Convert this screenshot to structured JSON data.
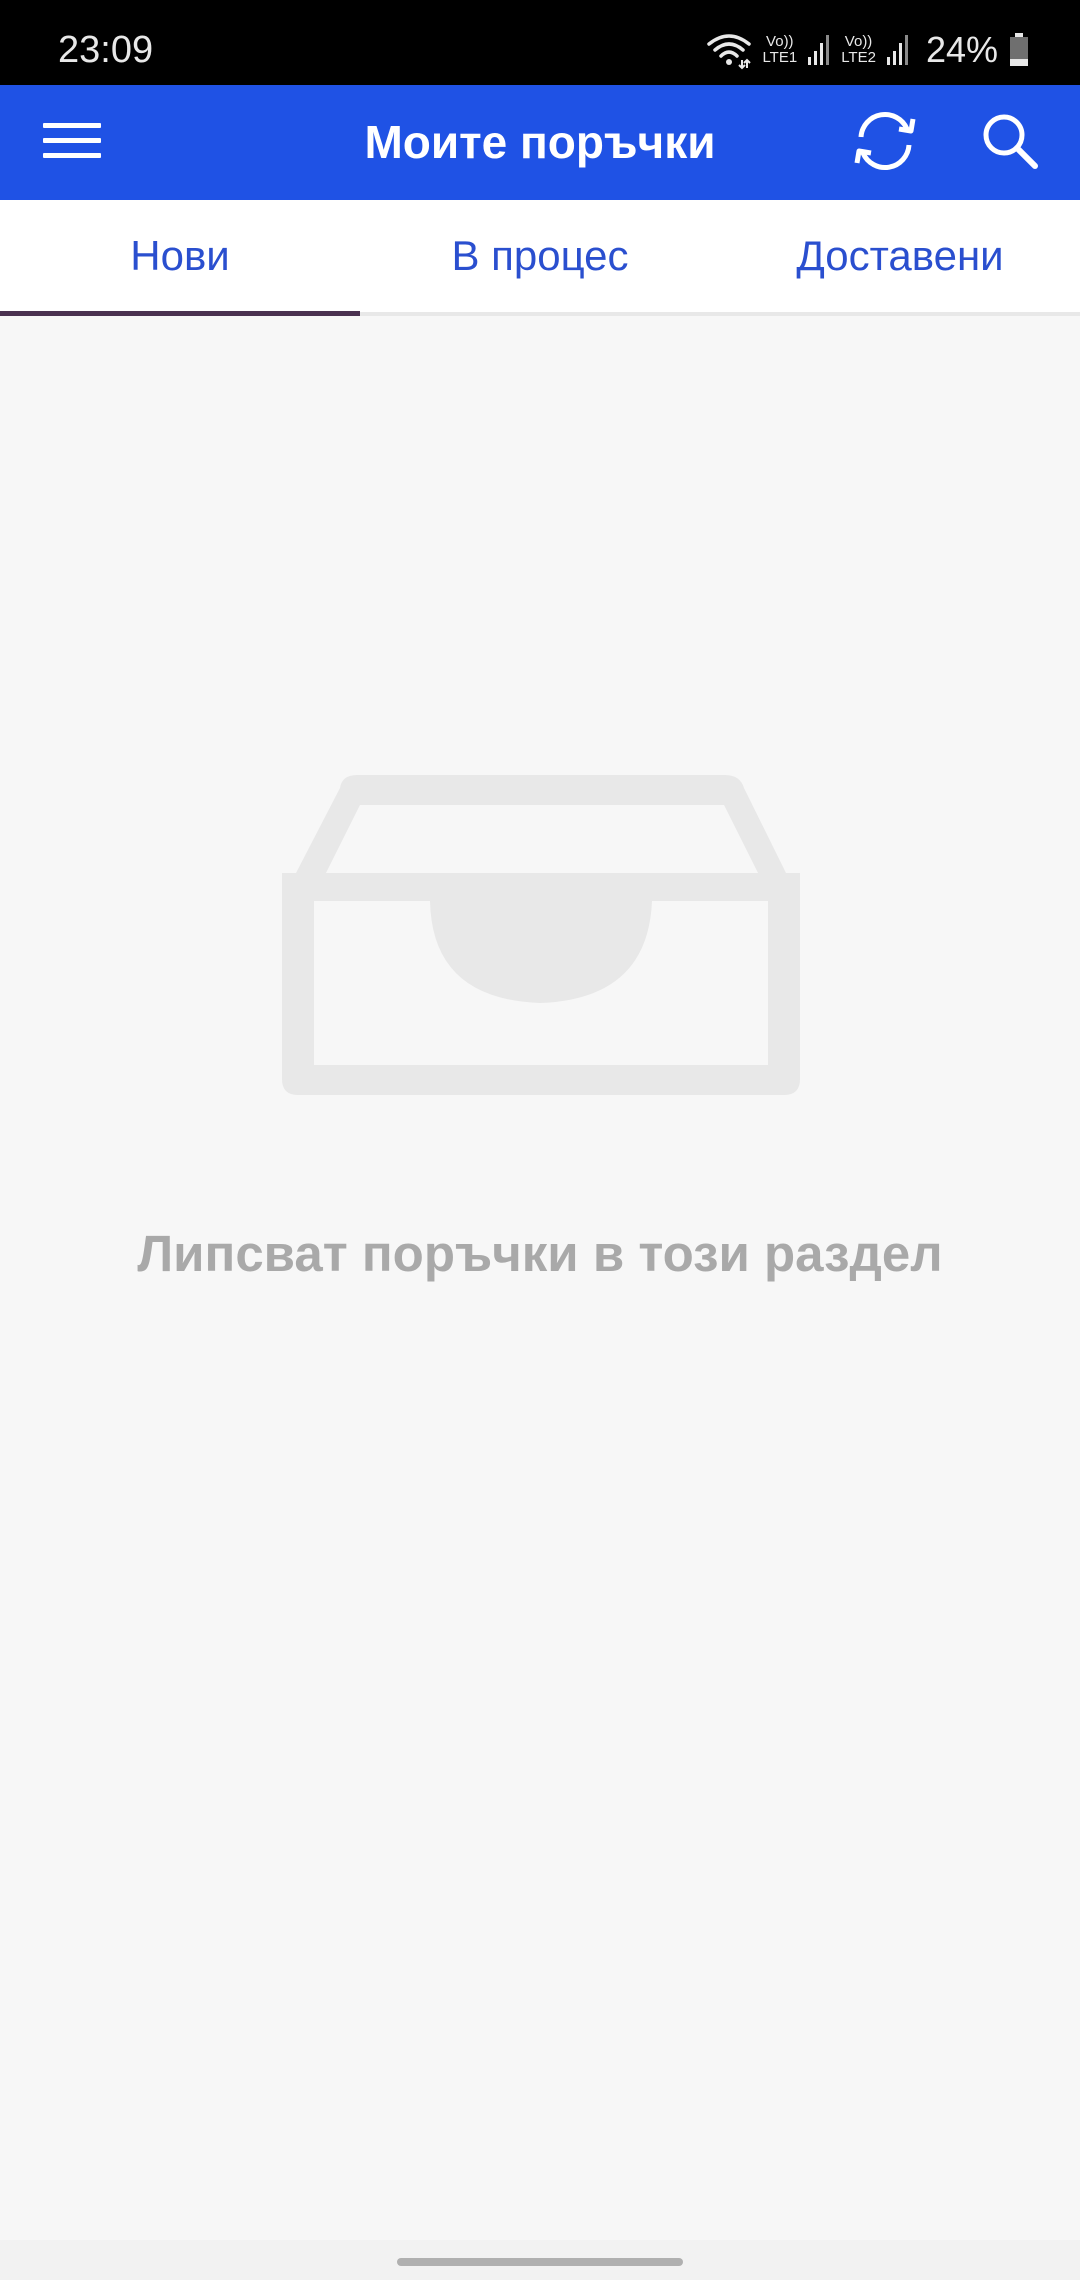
{
  "status_bar": {
    "time": "23:09",
    "sim1_volte": "Vo))",
    "sim1_network": "LTE1",
    "sim2_volte": "Vo))",
    "sim2_network": "LTE2",
    "battery_percent": "24%",
    "battery_level": 0.24,
    "icons": [
      "wifi-icon",
      "signal-icon",
      "signal-icon",
      "battery-icon"
    ]
  },
  "app_bar": {
    "title": "Моите поръчки",
    "background_color": "#1f52e5",
    "icons": [
      "menu-icon",
      "refresh-icon",
      "search-icon"
    ]
  },
  "tabs": [
    {
      "label": "Нови",
      "selected": true
    },
    {
      "label": "В процес",
      "selected": false
    },
    {
      "label": "Доставени",
      "selected": false
    }
  ],
  "tab_accent_color": "#2a4fcf",
  "empty_state": {
    "icon": "inbox-tray-icon",
    "message": "Липсват поръчки в този раздел"
  }
}
